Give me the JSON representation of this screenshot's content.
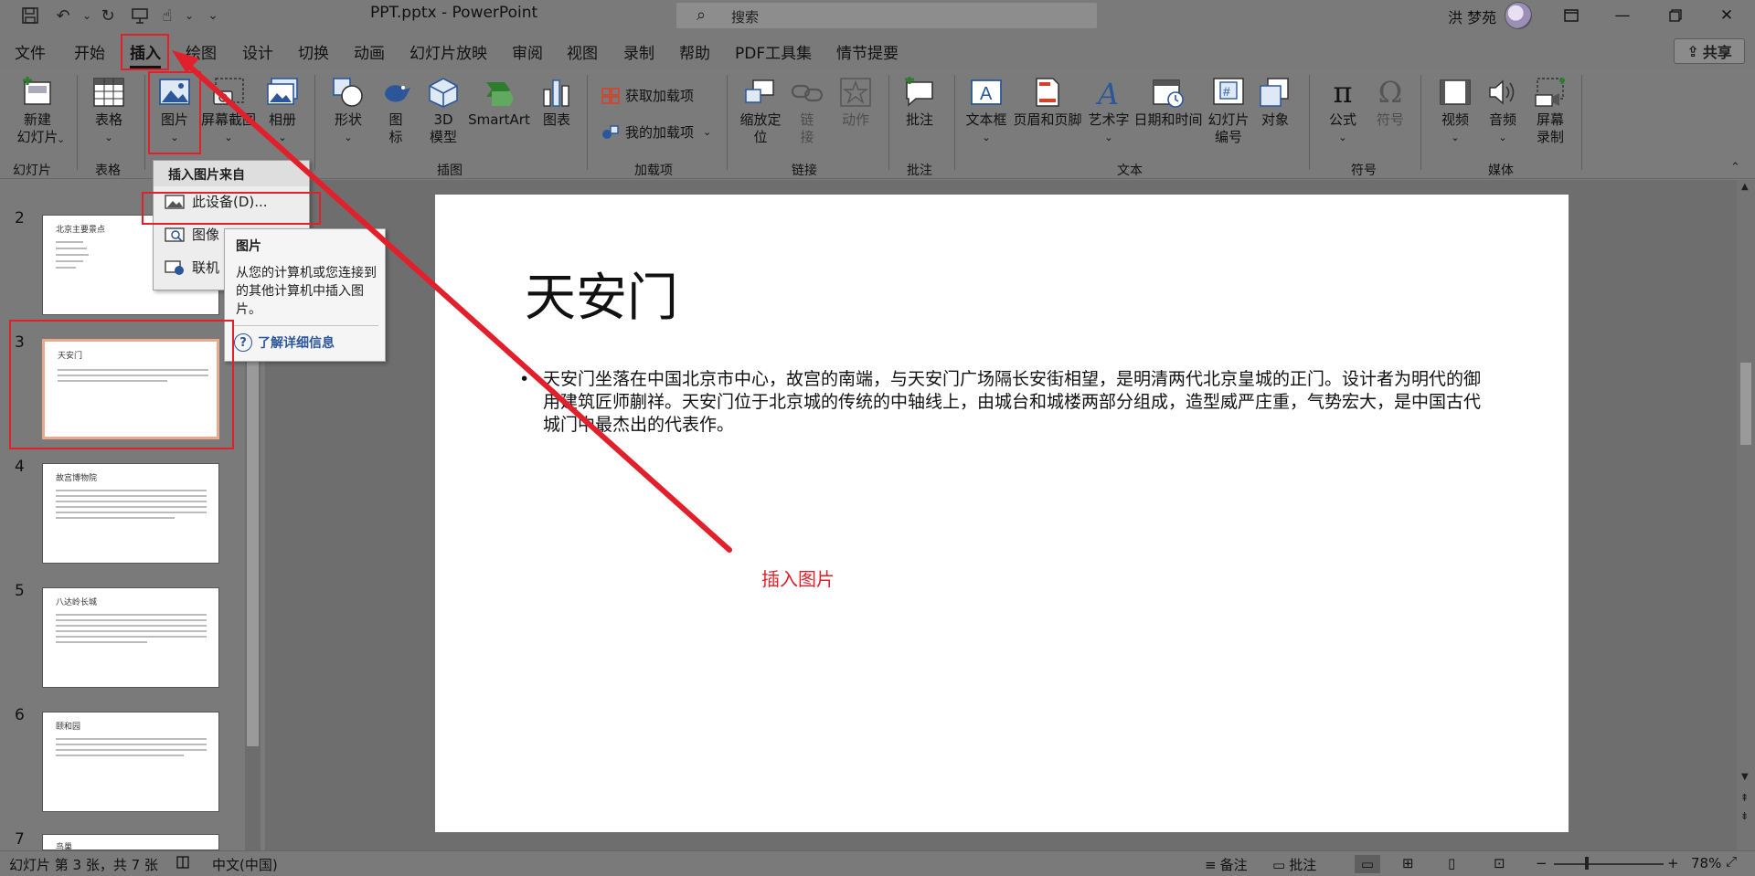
{
  "titlebar": {
    "doc_title": "PPT.pptx  -  PowerPoint",
    "search_placeholder": "搜索",
    "user_name": "洪 梦苑"
  },
  "menu": {
    "tabs": [
      "文件",
      "开始",
      "插入",
      "绘图",
      "设计",
      "切换",
      "动画",
      "幻灯片放映",
      "审阅",
      "视图",
      "录制",
      "帮助",
      "PDF工具集",
      "情节提要"
    ],
    "active_tab": "插入",
    "share": "共享"
  },
  "ribbon": {
    "new_slide": "新建\n幻灯片",
    "table": "表格",
    "picture": "图片",
    "screenshot": "屏幕截图",
    "album": "相册",
    "shapes": "形状",
    "icons": "图\n标",
    "model3d": "3D\n模型",
    "smartart": "SmartArt",
    "chart": "图表",
    "get_addins": "获取加载项",
    "my_addins": "我的加载项",
    "zoom": "缩放定\n位",
    "link": "链\n接",
    "action": "动作",
    "comment": "批注",
    "textbox": "文本框",
    "header_footer": "页眉和页脚",
    "wordart": "艺术字",
    "datetime": "日期和时间",
    "slide_number": "幻灯片\n编号",
    "object": "对象",
    "equation": "公式",
    "symbol": "符号",
    "video": "视频",
    "audio": "音频",
    "screen_record": "屏幕\n录制",
    "groups": {
      "slides": "幻灯片",
      "tables": "表格",
      "images": "插图",
      "addins": "加载项",
      "links": "链接",
      "comments": "批注",
      "text": "文本",
      "symbols": "符号",
      "media": "媒体"
    }
  },
  "dropdown": {
    "header": "插入图片来自",
    "items": [
      "此设备(D)...",
      "图像",
      "联机"
    ]
  },
  "tooltip": {
    "title": "图片",
    "description": "从您的计算机或您连接到的其他计算机中插入图片。",
    "link": "了解详细信息"
  },
  "thumbnails": [
    {
      "num": "2",
      "title": "北京主要景点"
    },
    {
      "num": "3",
      "title": "天安门"
    },
    {
      "num": "4",
      "title": "故宫博物院"
    },
    {
      "num": "5",
      "title": "八达岭长城"
    },
    {
      "num": "6",
      "title": "颐和园"
    },
    {
      "num": "7",
      "title": "鸟巢"
    }
  ],
  "slide": {
    "title": "天安门",
    "body": "天安门坐落在中国北京市中心，故宫的南端，与天安门广场隔长安街相望，是明清两代北京皇城的正门。设计者为明代的御用建筑匠师蒯祥。天安门位于北京城的传统的中轴线上，由城台和城楼两部分组成，造型威严庄重，气势宏大，是中国古代城门中最杰出的代表作。"
  },
  "annotation": "插入图片",
  "statusbar": {
    "slide_info": "幻灯片 第 3 张，共 7 张",
    "language": "中文(中国)",
    "notes": "备注",
    "comments": "批注",
    "zoom": "78%"
  },
  "colors": {
    "annotation_red": "#e2202b",
    "link_blue": "#2b579a",
    "selected_thumb_border": "#e8a98c"
  }
}
